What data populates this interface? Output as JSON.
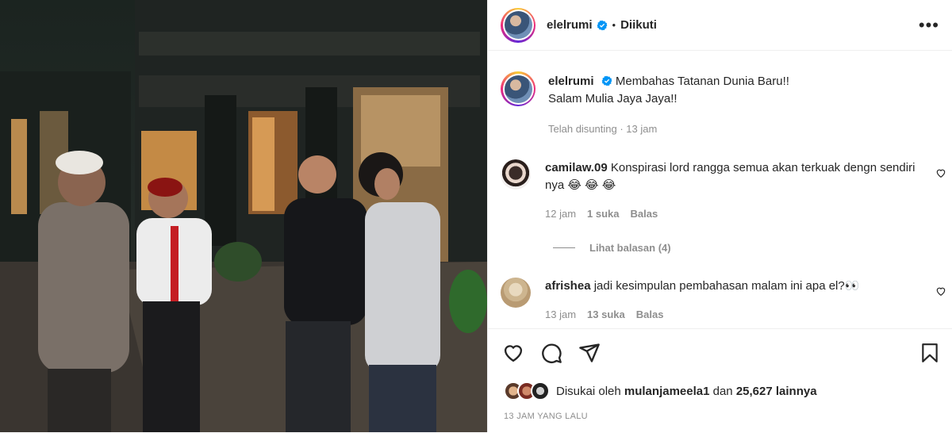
{
  "post": {
    "username": "elelrumi",
    "follow_status": "Diikuti",
    "caption_lines": [
      "Membahas Tatanan Dunia Baru!!",
      "Salam Mulia Jaya Jaya!!"
    ],
    "caption_meta": "Telah disunting · 13 jam"
  },
  "comments": [
    {
      "username": "camilaw.09",
      "text": "Konspirasi lord rangga semua akan terkuak dengn sendiri nya 😂 😂 😂",
      "time": "12 jam",
      "likes": "1 suka",
      "reply_label": "Balas"
    },
    {
      "username": "afrishea",
      "text": "jadi kesimpulan pembahasan malam ini apa el?👀",
      "time": "13 jam",
      "likes": "13 suka",
      "reply_label": "Balas"
    }
  ],
  "view_replies": "Lihat balasan (4)",
  "likes_summary": {
    "prefix": "Disukai oleh",
    "user": "mulanjameela1",
    "joiner": "dan",
    "count": "25,627 lainnya"
  },
  "time_ago": "13 JAM YANG LALU",
  "colors": {
    "verified": "#0095f6",
    "text": "#262626",
    "muted": "#8e8e8e",
    "border": "#efefef"
  },
  "icons": [
    "verified-badge-icon",
    "more-options-icon",
    "heart-icon",
    "comment-icon",
    "share-icon",
    "bookmark-icon"
  ]
}
